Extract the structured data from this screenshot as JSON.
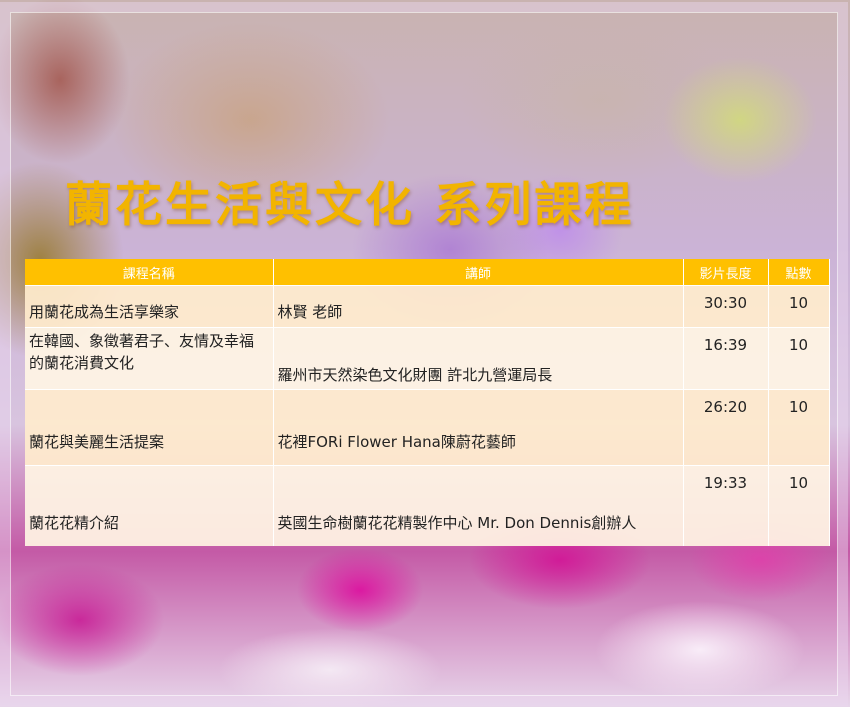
{
  "title": "蘭花生活與文化 系列課程",
  "colors": {
    "accent": "#ffc000",
    "title": "#f2b400"
  },
  "table": {
    "headers": [
      "課程名稱",
      "講師",
      "影片長度",
      "點數"
    ],
    "rows": [
      {
        "course": "用蘭花成為生活享樂家",
        "lecturer": "林賢 老師",
        "duration": "30:30",
        "points": "10"
      },
      {
        "course": "在韓國、象徵著君子、友情及幸福的蘭花消費文化",
        "lecturer": "羅州市天然染色文化財團 許北九營運局長",
        "duration": "16:39",
        "points": "10"
      },
      {
        "course": "蘭花與美麗生活提案",
        "lecturer": "花裡FORi Flower  Hana陳蔚花藝師",
        "duration": "26:20",
        "points": "10"
      },
      {
        "course": "蘭花花精介紹",
        "lecturer": "英國生命樹蘭花花精製作中心  Mr. Don Dennis創辦人",
        "duration": "19:33",
        "points": "10"
      }
    ]
  }
}
